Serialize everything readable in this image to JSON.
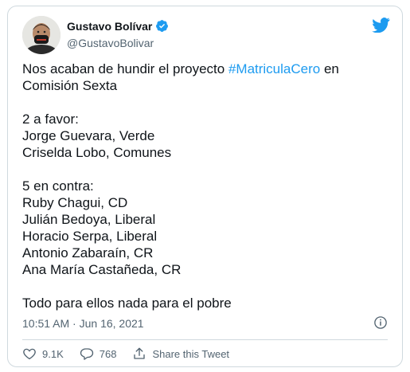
{
  "author": {
    "name": "Gustavo Bolívar",
    "handle": "@GustavoBolivar",
    "verified": true
  },
  "tweet": {
    "line1_prefix": "Nos acaban de hundir el proyecto ",
    "hashtag": "#MatriculaCero",
    "line1_suffix": " en",
    "line2": "Comisión Sexta",
    "favor_header": "2 a favor:",
    "favor": [
      "Jorge Guevara, Verde",
      "Criselda Lobo, Comunes"
    ],
    "contra_header": "5 en contra:",
    "contra": [
      "Ruby Chagui, CD",
      "Julián Bedoya, Liberal",
      "Horacio Serpa, Liberal",
      "Antonio Zabaraín, CR",
      "Ana María Castañeda, CR"
    ],
    "closing": "Todo para ellos nada para el pobre"
  },
  "meta": {
    "time": "10:51 AM",
    "separator": " · ",
    "date": "Jun 16, 2021"
  },
  "actions": {
    "likes": "9.1K",
    "replies": "768",
    "share": "Share this Tweet"
  },
  "colors": {
    "accent": "#1d9bf0",
    "text": "#0f1419",
    "muted": "#536471",
    "border": "#cfd9de"
  },
  "icons": [
    "twitter-bird-icon",
    "verified-badge-icon",
    "info-icon",
    "heart-icon",
    "reply-icon",
    "share-icon"
  ]
}
